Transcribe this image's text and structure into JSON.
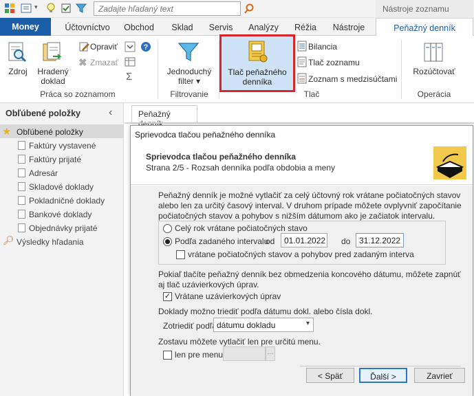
{
  "quick_access": {
    "search_placeholder": "Zadajte hľadaný text",
    "context_title": "Nástroje zoznamu"
  },
  "tabs": [
    "Money",
    "Účtovníctvo",
    "Obchod",
    "Sklad",
    "Servis",
    "Analýzy",
    "Réžia",
    "Nástroje",
    "Peňažný denník"
  ],
  "ribbon": {
    "zdroj": "Zdroj",
    "hradeny_doklad": [
      "Hradený",
      "doklad"
    ],
    "opravit": "Opraviť",
    "zmazat": "Zmazať",
    "group_praca": "Práca so zoznamom",
    "jednoduchy_filter": [
      "Jednoduchý",
      "filter ▾"
    ],
    "group_filtrovanie": "Filtrovanie",
    "tlac_pd": [
      "Tlač peňažného",
      "denníka"
    ],
    "bilancia": "Bilancia",
    "tlac_zoznamu": "Tlač zoznamu",
    "zoznam_medzisuctami": "Zoznam s medzisúčtami",
    "group_tlac": "Tlač",
    "rozuctovat": "Rozúčtovať",
    "group_operacia": "Operácia"
  },
  "left_panel": {
    "header": "Obľúbené položky",
    "collapse": "‹",
    "root": "Obľúbené položky",
    "items": [
      "Faktúry vystavené",
      "Faktúry prijaté",
      "Adresár",
      "Skladové doklady",
      "Pokladničné doklady",
      "Bankové doklady",
      "Objednávky prijaté"
    ],
    "search_results": "Výsledky hľadania"
  },
  "doc_tab": "Peňažný denník",
  "dialog": {
    "title": "Sprievodca tlačou peňažného denníka",
    "heading": "Sprievodca tlačou peňažného denníka",
    "step": "Strana 2/5 - Rozsah denníka podľa obdobia a meny",
    "intro": "Peňažný denník je možné vytlačiť za celý účtovný rok vrátane počiatočných stavov alebo len za určitý časový interval. V druhom prípade môžete ovplyvniť započítanie počiatočných stavov a pohybov s nižším dátumom ako je začiatok intervalu.",
    "radio_whole_year": "Celý rok vrátane počiatočných stavo",
    "radio_interval": "Podľa zadaného intervalu",
    "od_label": "od",
    "od_value": "01.01.2022",
    "do_label": "do",
    "do_value": "31.12.2022",
    "chk_initial": "vrátane počiatočných stavov a pohybov pred zadaným interva",
    "closing_text": "Pokiaľ tlačíte peňažný denník bez obmedzenia koncového dátumu, môžete zapnúť aj tlač uzávierkových úprav.",
    "chk_closing": "Vrátane uzávierkových úprav",
    "sort_text": "Doklady možno triediť podľa dátumu dokl. alebo čísla dokl.",
    "sort_label": "Zotriediť podľa",
    "sort_value": "dátumu dokladu",
    "menu_text": "Zostavu môžete vytlačiť len pre určitú menu.",
    "chk_menu": "len pre menu",
    "ellipsis": "···",
    "btn_back": "< Späť",
    "btn_next": "Ďalší >",
    "btn_close": "Zavrieť"
  },
  "colors": {
    "accent": "#1b5faa",
    "highlight_border": "#d9242b"
  }
}
